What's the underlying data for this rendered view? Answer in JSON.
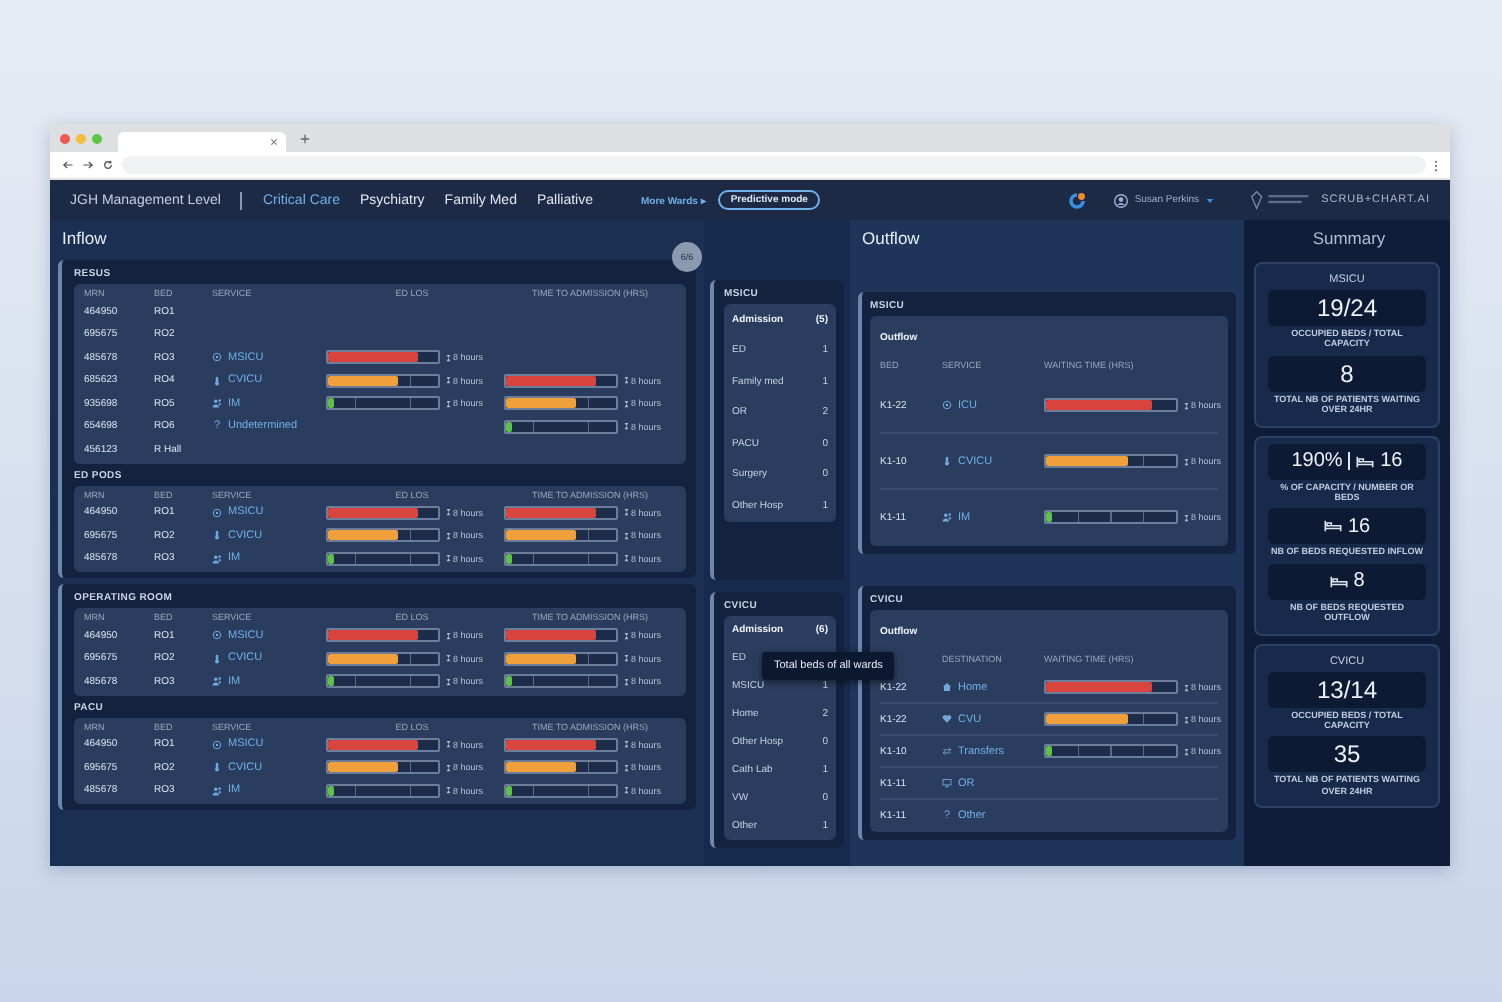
{
  "header": {
    "title": "JGH Management Level",
    "wards": [
      {
        "label": "Critical Care",
        "selected": true
      },
      {
        "label": "Psychiatry",
        "selected": false
      },
      {
        "label": "Family Med",
        "selected": false
      },
      {
        "label": "Palliative",
        "selected": false
      }
    ],
    "more": "More Wards ▸",
    "mode_button": "Predictive mode",
    "user": "Susan Perkins",
    "brand": "SCRUB+CHART.AI"
  },
  "inflow": {
    "title": "Inflow",
    "badge": "6/6",
    "groups": [
      {
        "sections": [
          {
            "title": "RESUS",
            "columns": [
              "MRN",
              "BED",
              "SERVICE",
              "ED LOS",
              "TIME TO ADMISSION (HRS)"
            ],
            "rows": [
              {
                "mrn": "464950",
                "bed": "RO1"
              },
              {
                "mrn": "695675",
                "bed": "RO2"
              },
              {
                "mrn": "485678",
                "bed": "RO3",
                "service": "MSICU",
                "kind": "target",
                "ed_los": {
                  "level": 0.82,
                  "reading": "8 hours"
                }
              },
              {
                "mrn": "685623",
                "bed": "RO4",
                "service": "CVICU",
                "kind": "thermometer",
                "ed_los": {
                  "level": 0.63,
                  "reading": "8 hours"
                },
                "admission": {
                  "level": 0.82,
                  "reading": "8 hours"
                }
              },
              {
                "mrn": "935698",
                "bed": "RO5",
                "service": "IM",
                "kind": "people",
                "ed_los": {
                  "level": 0.05,
                  "reading": "8 hours"
                },
                "admission": {
                  "level": 0.63,
                  "reading": "8 hours"
                }
              },
              {
                "mrn": "654698",
                "bed": "RO6",
                "service": "Undetermined",
                "kind": "unknown",
                "glyph": "?",
                "admission": {
                  "level": 0.05,
                  "reading": "8 hours"
                }
              },
              {
                "mrn": "456123",
                "bed": "R Hall"
              }
            ]
          },
          {
            "title": "ED PODS",
            "columns": [
              "MRN",
              "BED",
              "SERVICE",
              "ED LOS",
              "TIME TO ADMISSION (HRS)"
            ],
            "rows": [
              {
                "mrn": "464950",
                "bed": "RO1",
                "service": "MSICU",
                "kind": "target",
                "ed_los": {
                  "level": 0.82,
                  "reading": "8 hours"
                },
                "admission": {
                  "level": 0.82,
                  "reading": "8 hours"
                }
              },
              {
                "mrn": "695675",
                "bed": "RO2",
                "service": "CVICU",
                "kind": "thermometer",
                "ed_los": {
                  "level": 0.63,
                  "reading": "8 hours"
                },
                "admission": {
                  "level": 0.63,
                  "reading": "8 hours"
                }
              },
              {
                "mrn": "485678",
                "bed": "RO3",
                "service": "IM",
                "kind": "people",
                "ed_los": {
                  "level": 0.05,
                  "reading": "8 hours"
                },
                "admission": {
                  "level": 0.05,
                  "reading": "8 hours"
                }
              }
            ]
          }
        ]
      },
      {
        "sections": [
          {
            "title": "OPERATING ROOM",
            "columns": [
              "MRN",
              "BED",
              "SERVICE",
              "ED LOS",
              "TIME TO ADMISSION (HRS)"
            ],
            "rows": [
              {
                "mrn": "464950",
                "bed": "RO1",
                "service": "MSICU",
                "kind": "target",
                "ed_los": {
                  "level": 0.82,
                  "reading": "8 hours"
                },
                "admission": {
                  "level": 0.82,
                  "reading": "8 hours"
                }
              },
              {
                "mrn": "695675",
                "bed": "RO2",
                "service": "CVICU",
                "kind": "thermometer",
                "ed_los": {
                  "level": 0.63,
                  "reading": "8 hours"
                },
                "admission": {
                  "level": 0.63,
                  "reading": "8 hours"
                }
              },
              {
                "mrn": "485678",
                "bed": "RO3",
                "service": "IM",
                "kind": "people",
                "ed_los": {
                  "level": 0.05,
                  "reading": "8 hours"
                },
                "admission": {
                  "level": 0.05,
                  "reading": "8 hours"
                }
              }
            ]
          },
          {
            "title": "PACU",
            "columns": [
              "MRN",
              "BED",
              "SERVICE",
              "ED LOS",
              "TIME TO ADMISSION (HRS)"
            ],
            "rows": [
              {
                "mrn": "464950",
                "bed": "RO1",
                "service": "MSICU",
                "kind": "target",
                "ed_los": {
                  "level": 0.82,
                  "reading": "8 hours"
                },
                "admission": {
                  "level": 0.82,
                  "reading": "8 hours"
                }
              },
              {
                "mrn": "695675",
                "bed": "RO2",
                "service": "CVICU",
                "kind": "thermometer",
                "ed_los": {
                  "level": 0.63,
                  "reading": "8 hours"
                },
                "admission": {
                  "level": 0.63,
                  "reading": "8 hours"
                }
              },
              {
                "mrn": "485678",
                "bed": "RO3",
                "service": "IM",
                "kind": "people",
                "ed_los": {
                  "level": 0.05,
                  "reading": "8 hours"
                },
                "admission": {
                  "level": 0.05,
                  "reading": "8 hours"
                }
              }
            ]
          }
        ]
      }
    ]
  },
  "admissions": [
    {
      "title": "MSICU",
      "header": "Admission",
      "total": "(5)",
      "rows": [
        {
          "label": "ED",
          "value": "1"
        },
        {
          "label": "Family med",
          "value": "1"
        },
        {
          "label": "OR",
          "value": "2"
        },
        {
          "label": "PACU",
          "value": "0"
        },
        {
          "label": "Surgery",
          "value": "0"
        },
        {
          "label": "Other Hosp",
          "value": "1"
        }
      ]
    },
    {
      "title": "CVICU",
      "header": "Admission",
      "total": "(6)",
      "rows": [
        {
          "label": "ED"
        },
        {
          "label": "MSICU",
          "value": "1"
        },
        {
          "label": "Home",
          "value": "2"
        },
        {
          "label": "Other Hosp",
          "value": "0"
        },
        {
          "label": "Cath Lab",
          "value": "1"
        },
        {
          "label": "VW",
          "value": "0"
        },
        {
          "label": "Other",
          "value": "1"
        }
      ]
    }
  ],
  "tooltip": "Total beds of all wards",
  "outflow": {
    "title": "Outflow",
    "cards": [
      {
        "title": "MSICU",
        "header": "Outflow",
        "columns": [
          "BED",
          "SERVICE",
          "WAITING TIME (HRS)"
        ],
        "rows": [
          {
            "bed": "K1-22",
            "service": "ICU",
            "kind": "target",
            "wait": {
              "level": 0.82,
              "reading": "8 hours"
            }
          },
          {
            "bed": "K1-10",
            "service": "CVICU",
            "kind": "thermometer",
            "wait": {
              "level": 0.63,
              "reading": "8 hours"
            }
          },
          {
            "bed": "K1-11",
            "service": "IM",
            "kind": "people",
            "wait": {
              "level": 0.05,
              "reading": "8 hours"
            }
          }
        ]
      },
      {
        "title": "CVICU",
        "header": "Outflow",
        "columns": [
          "DESTINATION",
          "WAITING TIME (HRS)"
        ],
        "rows": [
          {
            "bed": "K1-22",
            "service": "Home",
            "kind": "house",
            "wait": {
              "level": 0.82,
              "reading": "8 hours"
            }
          },
          {
            "bed": "K1-22",
            "service": "CVU",
            "kind": "heart",
            "wait": {
              "level": 0.63,
              "reading": "8 hours"
            }
          },
          {
            "bed": "K1-10",
            "service": "Transfers",
            "kind": "arrows",
            "wait": {
              "level": 0.05,
              "reading": "8 hours"
            }
          },
          {
            "bed": "K1-11",
            "service": "OR",
            "kind": "monitor"
          },
          {
            "bed": "K1-11",
            "service": "Other",
            "kind": "unknown",
            "glyph": "?"
          }
        ]
      }
    ]
  },
  "summary": {
    "title": "Summary",
    "cards": [
      {
        "title": "MSICU",
        "stats": [
          {
            "kind": "plain",
            "value": "19/24",
            "label": "OCCUPIED BEDS / TOTAL CAPACITY"
          },
          {
            "kind": "plain",
            "value": "8",
            "label": "TOTAL NB OF PATIENTS WAITING OVER 24HR"
          }
        ]
      },
      {
        "stats": [
          {
            "kind": "capacity",
            "value": "190%",
            "beds": "16",
            "label": "% OF CAPACITY / NUMBER OR BEDS"
          },
          {
            "kind": "beds",
            "value": "16",
            "label": "NB OF BEDS REQUESTED INFLOW"
          },
          {
            "kind": "beds",
            "value": "8",
            "label": "NB OF BEDS REQUESTED OUTFLOW"
          }
        ]
      },
      {
        "title": "CVICU",
        "stats": [
          {
            "kind": "plain",
            "value": "13/14",
            "label": "OCCUPIED BEDS / TOTAL CAPACITY"
          },
          {
            "kind": "plain",
            "value": "35",
            "label": "TOTAL NB OF PATIENTS WAITING OVER 24HR"
          }
        ]
      }
    ]
  }
}
